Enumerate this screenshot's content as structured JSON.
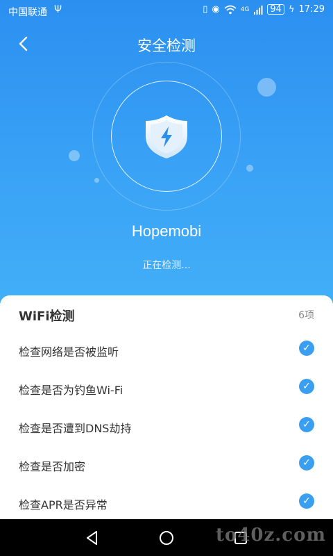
{
  "statusbar": {
    "carrier": "中国联通",
    "usb_icon": "usb-icon",
    "network": "4G",
    "battery": "94",
    "time": "17:29"
  },
  "header": {
    "title": "安全检测",
    "back_icon": "chevron-left-icon"
  },
  "scan": {
    "app_name": "Hopemobi",
    "status": "正在检测...",
    "shield_icon": "shield-lightning-icon"
  },
  "wifi_section": {
    "title": "WiFi检测",
    "count": "6项",
    "items": [
      {
        "label": "检查网络是否被监听",
        "checked": true
      },
      {
        "label": "检查是否为钓鱼Wi-Fi",
        "checked": true
      },
      {
        "label": "检查是否遭到DNS劫持",
        "checked": true
      },
      {
        "label": "检查是否加密",
        "checked": true
      },
      {
        "label": "检查APR是否异常",
        "checked": true
      }
    ]
  },
  "navbar": {
    "back": "triangle-back-icon",
    "home": "circle-home-icon",
    "recents": "square-recents-icon"
  },
  "watermark": "to40z.com",
  "colors": {
    "hero_top": "#2b8ff0",
    "hero_bottom": "#43b0f8",
    "check": "#3a9ff0"
  }
}
